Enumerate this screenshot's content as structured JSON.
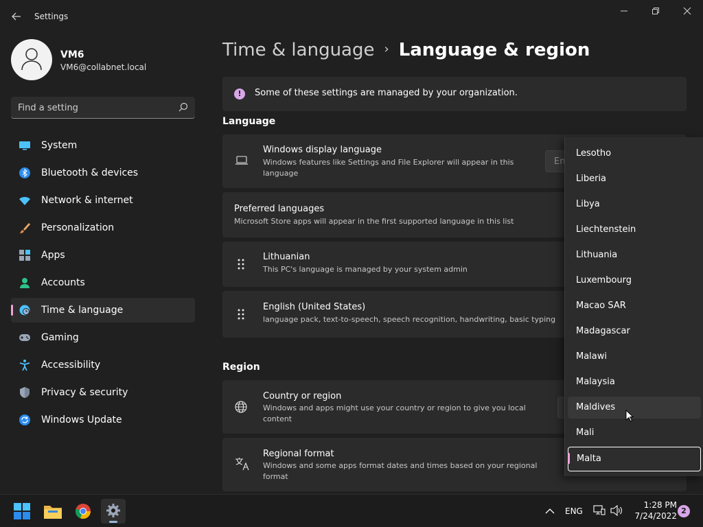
{
  "window": {
    "title": "Settings"
  },
  "profile": {
    "name": "VM6",
    "email": "VM6@collabnet.local"
  },
  "search": {
    "placeholder": "Find a setting"
  },
  "sidebar": {
    "items": [
      {
        "label": "System"
      },
      {
        "label": "Bluetooth & devices"
      },
      {
        "label": "Network & internet"
      },
      {
        "label": "Personalization"
      },
      {
        "label": "Apps"
      },
      {
        "label": "Accounts"
      },
      {
        "label": "Time & language"
      },
      {
        "label": "Gaming"
      },
      {
        "label": "Accessibility"
      },
      {
        "label": "Privacy & security"
      },
      {
        "label": "Windows Update"
      }
    ],
    "selected": "Time & language"
  },
  "header": {
    "parent": "Time & language",
    "current": "Language & region"
  },
  "info_bar": {
    "text": "Some of these settings are managed by your organization."
  },
  "language": {
    "section_title": "Language",
    "display_language": {
      "title": "Windows display language",
      "description": "Windows features like Settings and File Explorer will appear in this language",
      "value_visible": "En"
    },
    "preferred": {
      "title": "Preferred languages",
      "description": "Microsoft Store apps will appear in the first supported language in this list"
    },
    "languages": [
      {
        "title": "Lithuanian",
        "description": "This PC's language is managed by your system admin"
      },
      {
        "title": "English (United States)",
        "description": "language pack, text-to-speech, speech recognition, handwriting, basic typing"
      }
    ]
  },
  "region": {
    "section_title": "Region",
    "country": {
      "title": "Country or region",
      "description": "Windows and apps might use your country or region to give you local content"
    },
    "format": {
      "title": "Regional format",
      "description": "Windows and some apps format dates and times based on your regional format"
    }
  },
  "country_dropdown": {
    "options": [
      "Lesotho",
      "Liberia",
      "Libya",
      "Liechtenstein",
      "Lithuania",
      "Luxembourg",
      "Macao SAR",
      "Madagascar",
      "Malawi",
      "Malaysia",
      "Maldives",
      "Mali",
      "Malta"
    ],
    "hovered": "Maldives",
    "selected": "Malta"
  },
  "taskbar": {
    "language": "ENG",
    "time": "1:28 PM",
    "date": "7/24/2022",
    "notifications": "2"
  },
  "colors": {
    "accent": "#f0a3d8",
    "background": "#202020",
    "card": "#2b2b2b"
  }
}
